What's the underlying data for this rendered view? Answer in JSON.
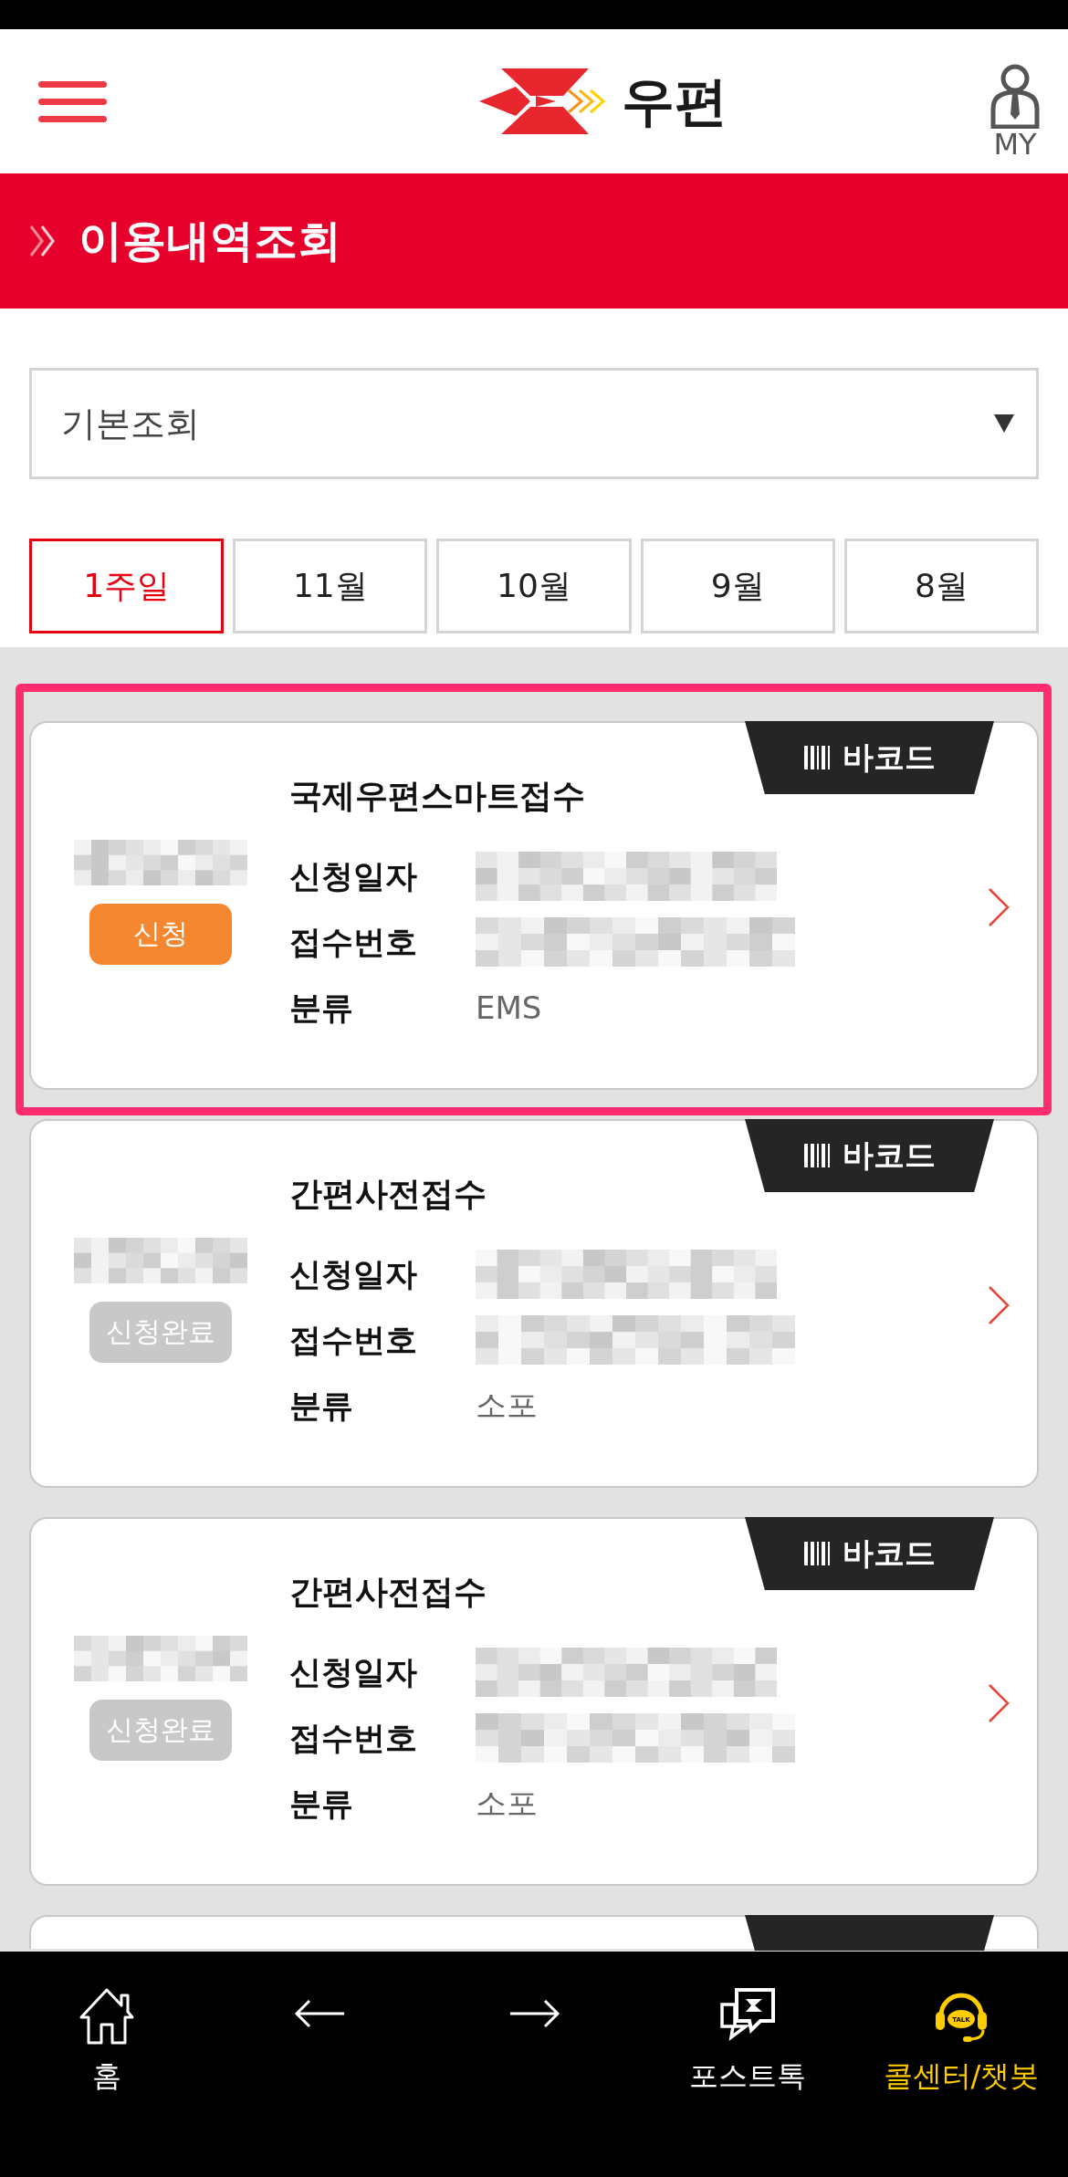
{
  "header": {
    "logo_text": "우편",
    "my_label": "MY"
  },
  "page_title": "이용내역조회",
  "filter": {
    "value": "기본조회"
  },
  "periods": [
    {
      "label": "1주일",
      "selected": true
    },
    {
      "label": "11월",
      "selected": false
    },
    {
      "label": "10월",
      "selected": false
    },
    {
      "label": "9월",
      "selected": false
    },
    {
      "label": "8월",
      "selected": false
    }
  ],
  "cards": [
    {
      "kind": "full",
      "highlighted": true,
      "title": "국제우편스마트접수",
      "barcode": "바코드",
      "badge": {
        "text": "신청",
        "color": "#f4872f"
      },
      "rows": [
        {
          "label": "신청일자",
          "redacted": true
        },
        {
          "label": "접수번호",
          "redacted": true
        },
        {
          "label": "분류",
          "value": "EMS"
        }
      ]
    },
    {
      "kind": "full",
      "highlighted": false,
      "title": "간편사전접수",
      "barcode": "바코드",
      "badge": {
        "text": "신청완료",
        "color": "#c8c8c8"
      },
      "rows": [
        {
          "label": "신청일자",
          "redacted": true
        },
        {
          "label": "접수번호",
          "redacted": true
        },
        {
          "label": "분류",
          "value": "소포"
        }
      ]
    },
    {
      "kind": "full",
      "highlighted": false,
      "title": "간편사전접수",
      "barcode": "바코드",
      "badge": {
        "text": "신청완료",
        "color": "#c8c8c8"
      },
      "rows": [
        {
          "label": "신청일자",
          "redacted": true
        },
        {
          "label": "접수번호",
          "redacted": true
        },
        {
          "label": "분류",
          "value": "소포"
        }
      ]
    },
    {
      "kind": "partial",
      "highlighted": false
    }
  ],
  "bottom_nav": [
    {
      "kind": "home",
      "label": "홈",
      "color": "#ffffff"
    },
    {
      "kind": "back",
      "color": "#ffffff"
    },
    {
      "kind": "forward",
      "color": "#ffffff"
    },
    {
      "kind": "posttalk",
      "label": "포스트톡",
      "color": "#ffffff"
    },
    {
      "kind": "callcenter",
      "label": "콜센터/챗봇",
      "icon_text": "TALK",
      "color": "#ffcc00"
    }
  ]
}
